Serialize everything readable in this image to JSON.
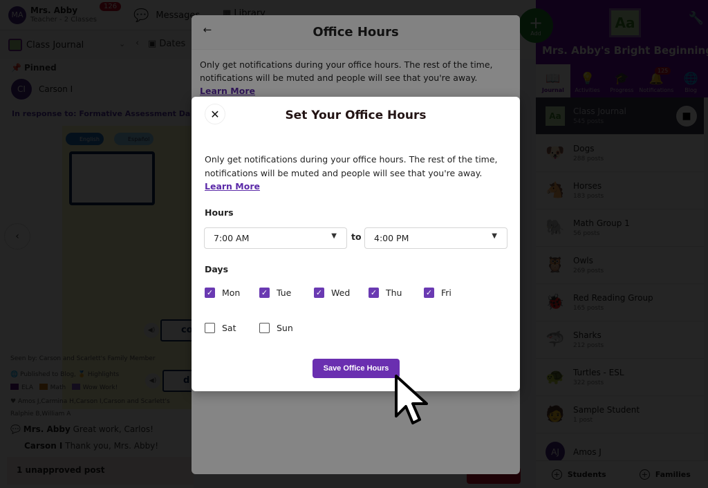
{
  "topbar": {
    "user_initials": "MA",
    "user_name": "Mrs. Abby",
    "user_role": "Teacher - 2 Classes",
    "notification_count": "126",
    "messages_label": "Messages",
    "library_label": "Library"
  },
  "subbar": {
    "class_selector": "Class Journal",
    "dates_label": "Dates"
  },
  "feed": {
    "pinned_label": "Pinned",
    "poster_initials": "CI",
    "poster_name": "Carson I",
    "response_to": "In response to: Formative Assessment Da",
    "lang_english": "English",
    "lang_spanish": "Español",
    "word_1": "co",
    "word_2": "d",
    "seen_by": "Seen by: Carson and Scarlett's Family Member",
    "published": "Published to Blog,",
    "highlights": "Highlights",
    "tags": [
      {
        "label": "ELA",
        "color": "#5a1a8a"
      },
      {
        "label": "Math",
        "color": "#c87a1a"
      },
      {
        "label": "Wow Work!",
        "color": "#8a5ac8"
      }
    ],
    "likes_line1": "Amos J,Carmina H,Carson I,Carson and Scarlett's",
    "likes_line2": "Ralphie B,William A",
    "comments": [
      {
        "author": "Mrs. Abby",
        "text": "Great work, Carlos!"
      },
      {
        "author": "Carson I",
        "text": "Thank you, Mrs. Abby!"
      }
    ],
    "unapproved": "1 unapproved post"
  },
  "add_button": {
    "label": "Add"
  },
  "sidebar": {
    "class_logo": "Aa",
    "class_title": "Mrs. Abby's Bright Beginnings",
    "tabs": [
      {
        "label": "Journal",
        "icon": "book-icon",
        "active": true
      },
      {
        "label": "Activities",
        "icon": "lightbulb-icon"
      },
      {
        "label": "Progress",
        "icon": "graduation-cap-icon"
      },
      {
        "label": "Notifications",
        "icon": "bell-icon",
        "badge": "125"
      },
      {
        "label": "Blog",
        "icon": "globe-icon"
      }
    ],
    "groups": [
      {
        "name": "Class Journal",
        "count": "545 posts",
        "icon": "Aa",
        "active": true
      },
      {
        "name": "Dogs",
        "count": "288 posts",
        "icon": "🐶"
      },
      {
        "name": "Horses",
        "count": "183 posts",
        "icon": "🐴"
      },
      {
        "name": "Math Group 1",
        "count": "56 posts",
        "icon": "🐘"
      },
      {
        "name": "Owls",
        "count": "269 posts",
        "icon": "🦉"
      },
      {
        "name": "Red Reading Group",
        "count": "165 posts",
        "icon": "🐞"
      },
      {
        "name": "Sharks",
        "count": "212 posts",
        "icon": "🦈"
      },
      {
        "name": "Turtles - ESL",
        "count": "322 posts",
        "icon": "🐢"
      },
      {
        "name": "Sample Student",
        "count": "1 post",
        "icon": "🧑"
      },
      {
        "name": "Amos J",
        "count": "",
        "icon": "AJ"
      }
    ],
    "footer": {
      "students": "Students",
      "families": "Families"
    }
  },
  "office_hours_panel": {
    "title": "Office Hours",
    "description": "Only get notifications during your office hours. The rest of the time, notifications will be muted and people will see that you're away.",
    "learn_more": "Learn More"
  },
  "modal": {
    "title": "Set Your Office Hours",
    "description": "Only get notifications during your office hours. The rest of the time, notifications will be muted and people will see that you're away.",
    "learn_more": "Learn More",
    "hours_label": "Hours",
    "start_time": "7:00 AM",
    "to_label": "to",
    "end_time": "4:00 PM",
    "days_label": "Days",
    "days": [
      {
        "label": "Mon",
        "checked": true
      },
      {
        "label": "Tue",
        "checked": true
      },
      {
        "label": "Wed",
        "checked": true
      },
      {
        "label": "Thu",
        "checked": true
      },
      {
        "label": "Fri",
        "checked": true
      },
      {
        "label": "Sat",
        "checked": false
      },
      {
        "label": "Sun",
        "checked": false
      }
    ],
    "save_label": "Save Office Hours",
    "accent_color": "#6a2fb0"
  }
}
